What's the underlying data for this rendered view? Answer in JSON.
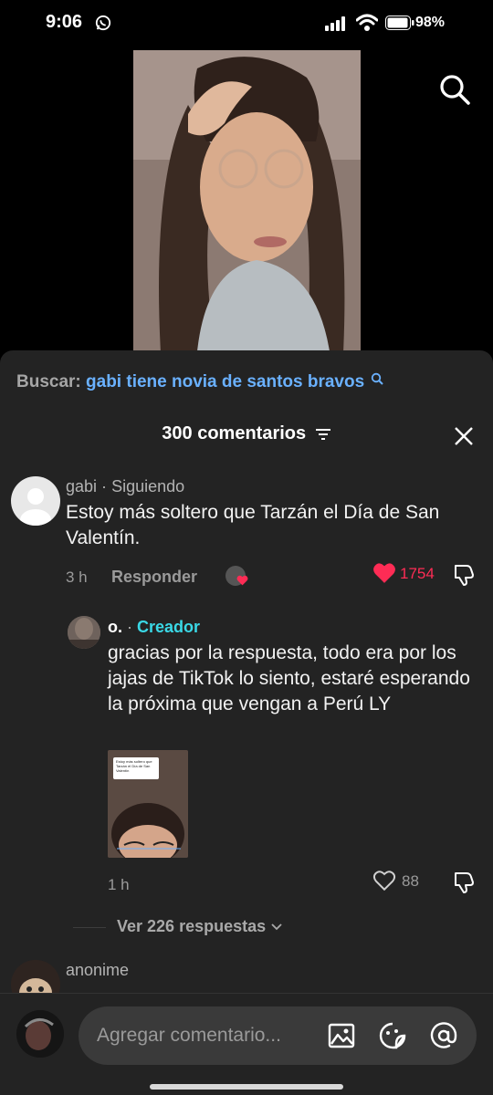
{
  "status_bar": {
    "time": "9:06",
    "battery": "98%",
    "icons": [
      "whatsapp-icon",
      "signal-icon",
      "wifi-icon",
      "battery-icon"
    ]
  },
  "search": {
    "label": "Buscar:",
    "term": "gabi tiene novia de santos bravos"
  },
  "comments": {
    "header": "300 comentarios",
    "items": [
      {
        "username": "gabi",
        "tag": "Siguiendo",
        "text": "Estoy más soltero que Tarzán el Día de San Valentín.",
        "time": "3 h",
        "reply_label": "Responder",
        "likes": "1754",
        "liked": true,
        "replies": [
          {
            "username": "o.",
            "tag": "Creador",
            "text": "gracias por la respuesta, todo era por los jajas de TikTok lo siento, estaré esperando la próxima que vengan a Perú LY",
            "time": "1 h",
            "likes": "88",
            "thumbnail_text": "Estoy más soltero que Tarzán el Día de San Valentín"
          }
        ],
        "view_replies": "Ver 226 respuestas"
      },
      {
        "username": "anonime"
      }
    ]
  },
  "composer": {
    "placeholder": "Agregar comentario..."
  },
  "colors": {
    "accent_link": "#6ab1ff",
    "creator_tag": "#3ad8e6",
    "like_red": "#fe2c55",
    "sheet_bg": "#232323"
  }
}
